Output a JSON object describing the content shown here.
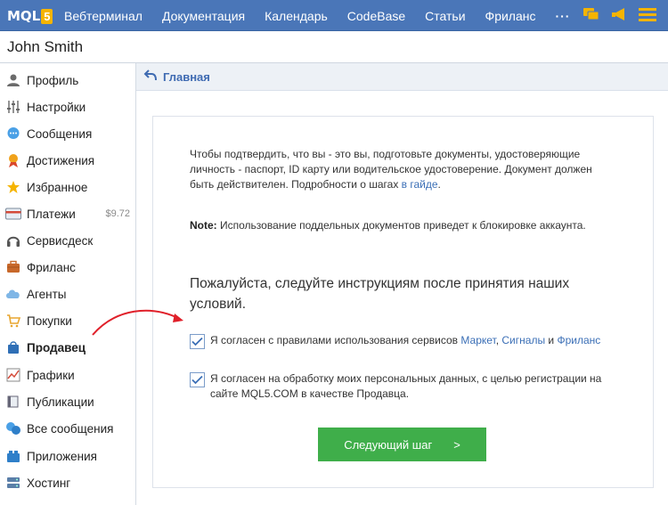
{
  "topbar": {
    "logo_text": "MQL",
    "logo_num": "5",
    "nav": [
      "Вебтерминал",
      "Документация",
      "Календарь",
      "CodeBase",
      "Статьи",
      "Фриланс",
      "···"
    ],
    "icons": [
      "chat-icon",
      "megaphone-icon",
      "menu-icon"
    ],
    "accent": "#4a76b8"
  },
  "user": {
    "name": "John Smith"
  },
  "sidebar": {
    "items": [
      {
        "label": "Профиль",
        "icon": "user-icon"
      },
      {
        "label": "Настройки",
        "icon": "sliders-icon"
      },
      {
        "label": "Сообщения",
        "icon": "chat-bubble-icon"
      },
      {
        "label": "Достижения",
        "icon": "medal-icon"
      },
      {
        "label": "Избранное",
        "icon": "star-icon"
      },
      {
        "label": "Платежи",
        "icon": "card-icon",
        "badge": "$9.72"
      },
      {
        "label": "Сервисдеск",
        "icon": "headset-icon"
      },
      {
        "label": "Фриланс",
        "icon": "briefcase-icon"
      },
      {
        "label": "Агенты",
        "icon": "cloud-icon"
      },
      {
        "label": "Покупки",
        "icon": "cart-icon"
      },
      {
        "label": "Продавец",
        "icon": "bag-icon",
        "active": true
      },
      {
        "label": "Графики",
        "icon": "chart-icon"
      },
      {
        "label": "Публикации",
        "icon": "book-icon"
      },
      {
        "label": "Все сообщения",
        "icon": "forum-icon"
      },
      {
        "label": "Приложения",
        "icon": "apps-icon"
      },
      {
        "label": "Хостинг",
        "icon": "server-icon"
      }
    ]
  },
  "breadcrumb": {
    "label": "Главная"
  },
  "main": {
    "intro": "Чтобы подтвердить, что вы - это вы, подготовьте документы, удостоверяющие личность - паспорт, ID карту или водительское удостоверение. Документ должен быть действителен. Подробности о шагах",
    "intro_link": "в гайде",
    "intro_end": ".",
    "note_label": "Note:",
    "note_text": "Использование поддельных документов приведет к блокировке аккаунта.",
    "heading": "Пожалуйста, следуйте инструкциям после принятия наших условий.",
    "check1_text": "Я согласен с правилами использования сервисов",
    "check1_link1": "Маркет",
    "check1_sep": ",",
    "check1_link2": "Сигналы",
    "check1_and": "и",
    "check1_link3": "Фриланс",
    "check2_text": "Я согласен на обработку моих персональных данных, с целью регистрации на сайте MQL5.COM в качестве Продавца.",
    "next_button": "Следующий шаг",
    "next_arrow": ">"
  }
}
